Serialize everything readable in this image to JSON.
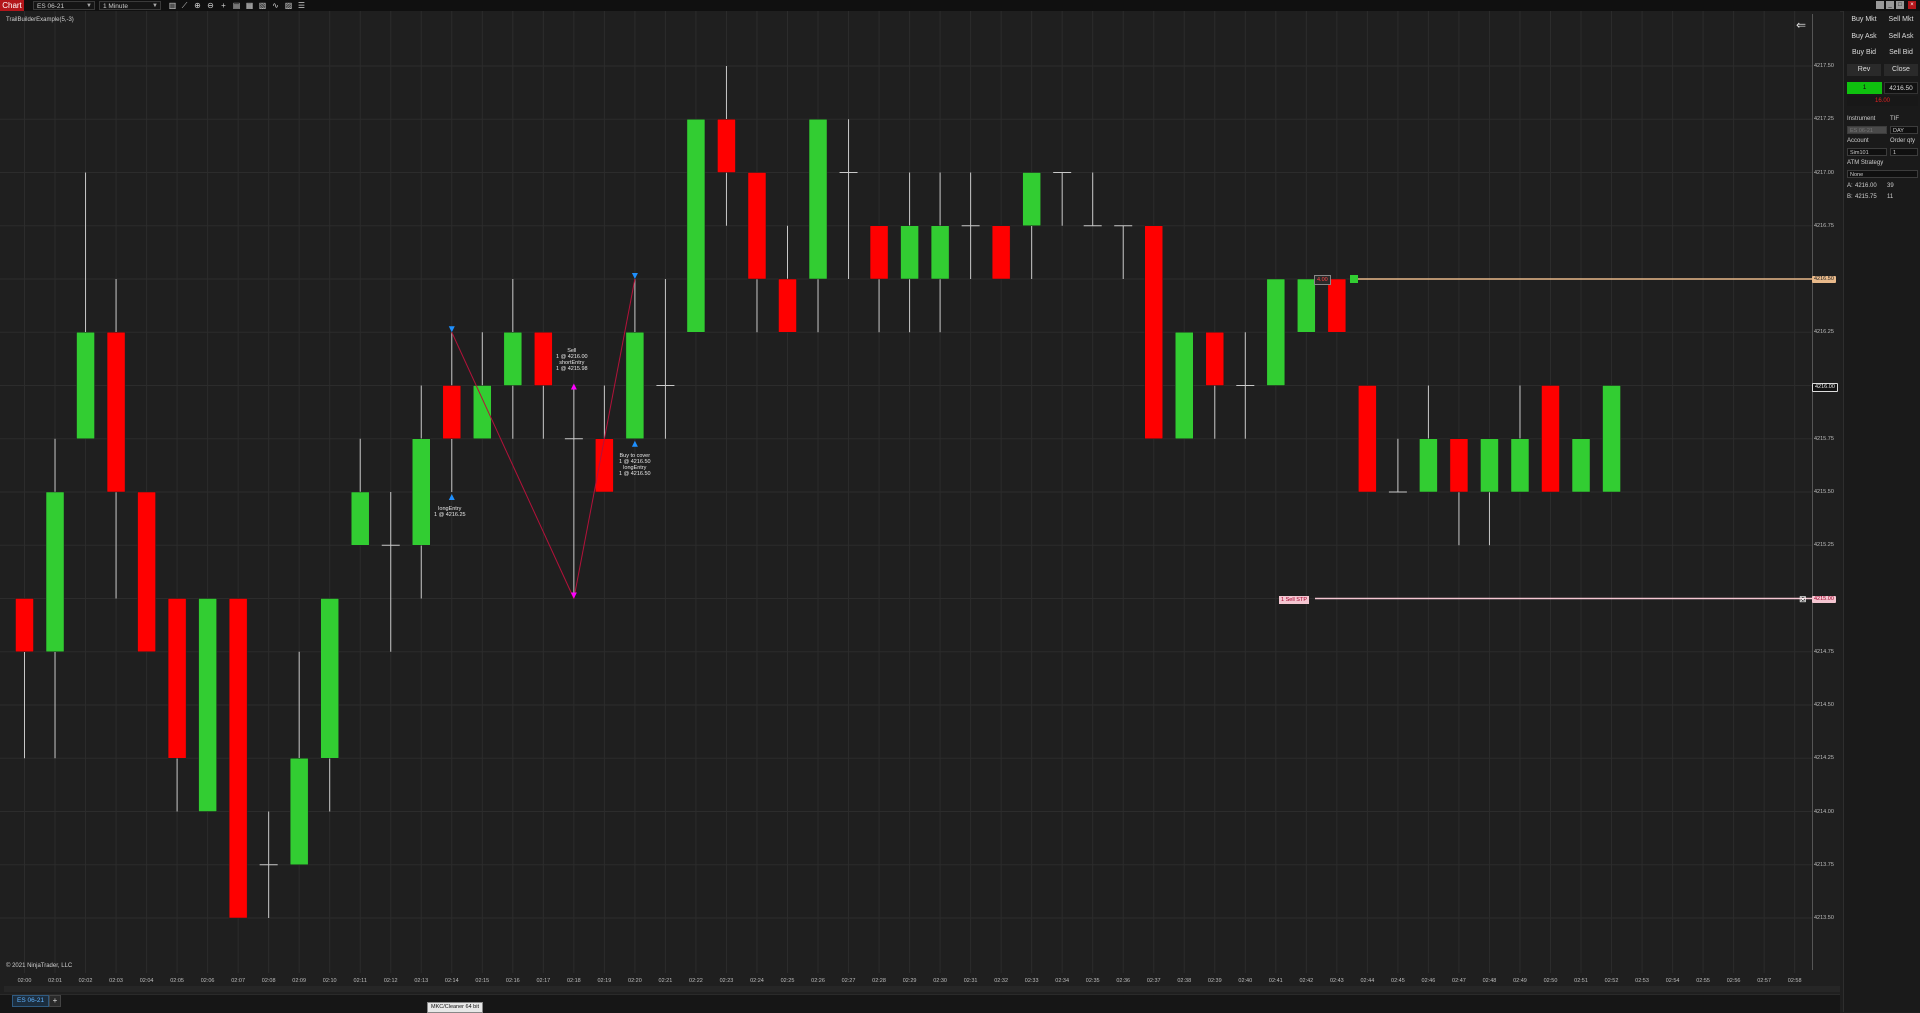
{
  "toolbar": {
    "chart_tab": "Chart",
    "instrument": "ES 06-21",
    "interval": "1 Minute",
    "icons": [
      "bar-type-icon",
      "draw-icon",
      "zoom-in-icon",
      "zoom-out-icon",
      "crosshair-icon",
      "data-box-icon",
      "properties-icon",
      "template-icon",
      "indicators-icon",
      "strategies-icon",
      "drawing-objects-icon"
    ]
  },
  "chart": {
    "indicator_label": "TrailBuilderExample(5,-3)",
    "copyright": "© 2021 NinjaTrader, LLC",
    "y_ticks": [
      "4217.50",
      "4217.25",
      "4217.00",
      "4216.75",
      "4216.50",
      "4216.25",
      "4216.00",
      "4215.75",
      "4215.50",
      "4215.25",
      "4215.00",
      "4214.75",
      "4214.50",
      "4214.25",
      "4214.00",
      "4213.75",
      "4213.50"
    ],
    "x_ticks": [
      "02:00",
      "02:01",
      "02:02",
      "02:03",
      "02:04",
      "02:05",
      "02:06",
      "02:07",
      "02:08",
      "02:09",
      "02:10",
      "02:11",
      "02:12",
      "02:13",
      "02:14",
      "02:15",
      "02:16",
      "02:17",
      "02:18",
      "02:19",
      "02:20",
      "02:21",
      "02:22",
      "02:23",
      "02:24",
      "02:25",
      "02:26",
      "02:27",
      "02:28",
      "02:29",
      "02:30",
      "02:31",
      "02:32",
      "02:33",
      "02:34",
      "02:35",
      "02:36",
      "02:37",
      "02:38",
      "02:39",
      "02:40",
      "02:41",
      "02:42",
      "02:43",
      "02:44",
      "02:45",
      "02:46",
      "02:47",
      "02:48",
      "02:49",
      "02:50",
      "02:51",
      "02:52",
      "02:53",
      "02:54",
      "02:55",
      "02:56",
      "02:57",
      "02:58"
    ],
    "ylim": [
      4213.375,
      4217.875
    ],
    "colors": {
      "up": "#32cd32",
      "down": "#ff0000",
      "grid": "#2c2c2c",
      "trade_line": "#b3123a",
      "entry_marker": "#1e90ff",
      "exit_marker": "#ff00ff"
    },
    "price_flags": {
      "last": "4216.00",
      "position": "4216.50",
      "stop": "4215.00"
    },
    "trade_notes": {
      "entry1": "longEntry\n1 @ 4216.25",
      "exit1": "Sell\n1 @ 4216.00\nshortEntry\n1 @ 4215.98",
      "cover": "Buy to cover\n1 @ 4216.50\nlongEntry\n1 @ 4216.50"
    },
    "orders": {
      "position_tag": "4.00",
      "stop_tag": "1  Sell STP"
    }
  },
  "chart_data": {
    "type": "candlestick",
    "ylim": [
      4213.375,
      4217.875
    ],
    "candles": [
      {
        "t": "02:00",
        "o": 4215.0,
        "h": 4215.0,
        "l": 4214.25,
        "c": 4214.75
      },
      {
        "t": "02:01",
        "o": 4214.75,
        "h": 4215.75,
        "l": 4214.25,
        "c": 4215.5
      },
      {
        "t": "02:02",
        "o": 4215.75,
        "h": 4217.0,
        "l": 4215.75,
        "c": 4216.25
      },
      {
        "t": "02:03",
        "o": 4216.25,
        "h": 4216.5,
        "l": 4215.0,
        "c": 4215.5
      },
      {
        "t": "02:04",
        "o": 4215.5,
        "h": 4215.5,
        "l": 4214.75,
        "c": 4214.75
      },
      {
        "t": "02:05",
        "o": 4215.0,
        "h": 4215.0,
        "l": 4214.0,
        "c": 4214.25
      },
      {
        "t": "02:06",
        "o": 4214.0,
        "h": 4215.0,
        "l": 4214.0,
        "c": 4215.0
      },
      {
        "t": "02:07",
        "o": 4215.0,
        "h": 4215.0,
        "l": 4213.5,
        "c": 4213.5
      },
      {
        "t": "02:08",
        "o": 4213.75,
        "h": 4214.0,
        "l": 4213.5,
        "c": 4213.75
      },
      {
        "t": "02:09",
        "o": 4213.75,
        "h": 4214.75,
        "l": 4213.75,
        "c": 4214.25
      },
      {
        "t": "02:10",
        "o": 4214.25,
        "h": 4215.0,
        "l": 4214.0,
        "c": 4215.0
      },
      {
        "t": "02:11",
        "o": 4215.25,
        "h": 4215.75,
        "l": 4215.25,
        "c": 4215.5
      },
      {
        "t": "02:12",
        "o": 4215.25,
        "h": 4215.5,
        "l": 4214.75,
        "c": 4215.25
      },
      {
        "t": "02:13",
        "o": 4215.25,
        "h": 4216.0,
        "l": 4215.0,
        "c": 4215.75
      },
      {
        "t": "02:14",
        "o": 4216.0,
        "h": 4216.25,
        "l": 4215.5,
        "c": 4215.75
      },
      {
        "t": "02:15",
        "o": 4215.75,
        "h": 4216.25,
        "l": 4215.75,
        "c": 4216.0
      },
      {
        "t": "02:16",
        "o": 4216.0,
        "h": 4216.5,
        "l": 4215.75,
        "c": 4216.25
      },
      {
        "t": "02:17",
        "o": 4216.25,
        "h": 4216.25,
        "l": 4215.75,
        "c": 4216.0
      },
      {
        "t": "02:18",
        "o": 4215.75,
        "h": 4216.0,
        "l": 4215.0,
        "c": 4215.75
      },
      {
        "t": "02:19",
        "o": 4215.75,
        "h": 4216.0,
        "l": 4215.5,
        "c": 4215.5
      },
      {
        "t": "02:20",
        "o": 4215.75,
        "h": 4216.5,
        "l": 4215.75,
        "c": 4216.25
      },
      {
        "t": "02:21",
        "o": 4216.0,
        "h": 4216.5,
        "l": 4215.75,
        "c": 4216.0
      },
      {
        "t": "02:22",
        "o": 4216.25,
        "h": 4217.25,
        "l": 4216.25,
        "c": 4217.25
      },
      {
        "t": "02:23",
        "o": 4217.25,
        "h": 4217.5,
        "l": 4216.75,
        "c": 4217.0
      },
      {
        "t": "02:24",
        "o": 4217.0,
        "h": 4217.0,
        "l": 4216.25,
        "c": 4216.5
      },
      {
        "t": "02:25",
        "o": 4216.5,
        "h": 4216.75,
        "l": 4216.25,
        "c": 4216.25
      },
      {
        "t": "02:26",
        "o": 4216.5,
        "h": 4217.25,
        "l": 4216.25,
        "c": 4217.25
      },
      {
        "t": "02:27",
        "o": 4217.0,
        "h": 4217.25,
        "l": 4216.5,
        "c": 4217.0
      },
      {
        "t": "02:28",
        "o": 4216.75,
        "h": 4216.75,
        "l": 4216.25,
        "c": 4216.5
      },
      {
        "t": "02:29",
        "o": 4216.5,
        "h": 4217.0,
        "l": 4216.25,
        "c": 4216.75
      },
      {
        "t": "02:30",
        "o": 4216.5,
        "h": 4217.0,
        "l": 4216.25,
        "c": 4216.75
      },
      {
        "t": "02:31",
        "o": 4216.75,
        "h": 4217.0,
        "l": 4216.5,
        "c": 4216.75
      },
      {
        "t": "02:32",
        "o": 4216.75,
        "h": 4216.75,
        "l": 4216.5,
        "c": 4216.5
      },
      {
        "t": "02:33",
        "o": 4216.75,
        "h": 4217.0,
        "l": 4216.5,
        "c": 4217.0
      },
      {
        "t": "02:34",
        "o": 4217.0,
        "h": 4217.0,
        "l": 4216.75,
        "c": 4217.0
      },
      {
        "t": "02:35",
        "o": 4216.75,
        "h": 4217.0,
        "l": 4216.75,
        "c": 4216.75
      },
      {
        "t": "02:36",
        "o": 4216.75,
        "h": 4216.75,
        "l": 4216.5,
        "c": 4216.75
      },
      {
        "t": "02:37",
        "o": 4216.75,
        "h": 4216.75,
        "l": 4215.75,
        "c": 4215.75
      },
      {
        "t": "02:38",
        "o": 4215.75,
        "h": 4216.25,
        "l": 4215.75,
        "c": 4216.25
      },
      {
        "t": "02:39",
        "o": 4216.25,
        "h": 4216.25,
        "l": 4215.75,
        "c": 4216.0
      },
      {
        "t": "02:40",
        "o": 4216.0,
        "h": 4216.25,
        "l": 4215.75,
        "c": 4216.0
      },
      {
        "t": "02:41",
        "o": 4216.0,
        "h": 4216.5,
        "l": 4216.0,
        "c": 4216.5
      },
      {
        "t": "02:42",
        "o": 4216.25,
        "h": 4216.5,
        "l": 4216.25,
        "c": 4216.5
      },
      {
        "t": "02:43",
        "o": 4216.5,
        "h": 4216.5,
        "l": 4216.25,
        "c": 4216.25
      },
      {
        "t": "02:44",
        "o": 4216.0,
        "h": 4216.0,
        "l": 4215.5,
        "c": 4215.5
      },
      {
        "t": "02:45",
        "o": 4215.5,
        "h": 4215.75,
        "l": 4215.5,
        "c": 4215.5
      },
      {
        "t": "02:46",
        "o": 4215.5,
        "h": 4216.0,
        "l": 4215.5,
        "c": 4215.75
      },
      {
        "t": "02:47",
        "o": 4215.75,
        "h": 4215.75,
        "l": 4215.25,
        "c": 4215.5
      },
      {
        "t": "02:48",
        "o": 4215.5,
        "h": 4215.75,
        "l": 4215.25,
        "c": 4215.75
      },
      {
        "t": "02:49",
        "o": 4215.5,
        "h": 4216.0,
        "l": 4215.5,
        "c": 4215.75
      },
      {
        "t": "02:50",
        "o": 4216.0,
        "h": 4216.0,
        "l": 4215.5,
        "c": 4215.5
      },
      {
        "t": "02:51",
        "o": 4215.5,
        "h": 4215.75,
        "l": 4215.5,
        "c": 4215.75
      },
      {
        "t": "02:52",
        "o": 4215.5,
        "h": 4216.0,
        "l": 4215.5,
        "c": 4216.0
      }
    ]
  },
  "chart_trader": {
    "buttons": [
      "Buy Mkt",
      "Sell Mkt",
      "Buy Ask",
      "Sell Ask",
      "Buy Bid",
      "Sell Bid",
      "Rev",
      "Close"
    ],
    "position_qty": "1",
    "position_price": "4216.50",
    "pnl": "16.00",
    "labels": {
      "instrument": "Instrument",
      "tif": "TIF",
      "account": "Account",
      "order_qty": "Order qty",
      "atm": "ATM Strategy"
    },
    "instrument_value": "ES 06-21",
    "tif_value": "DAY",
    "account_value": "Sim101",
    "qty_value": "1",
    "atm_value": "None",
    "ask_label": "A:",
    "ask_price": "4216.00",
    "ask_size": "39",
    "bid_label": "B:",
    "bid_price": "4215.75",
    "bid_size": "11"
  },
  "tabs": {
    "active": "ES 06-21",
    "add": "+"
  },
  "status_tooltip": "MKC/Cleaner 64 bit"
}
